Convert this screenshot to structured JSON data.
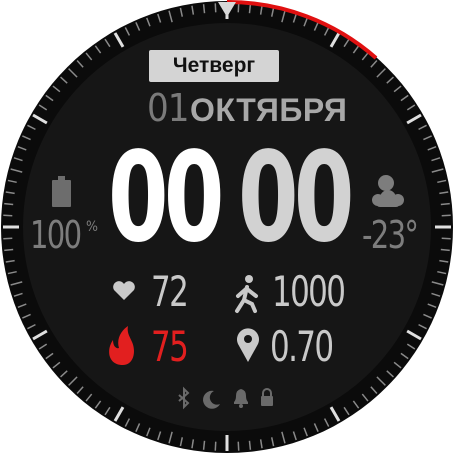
{
  "date": {
    "weekday": "Четверг",
    "day": "01",
    "month": "ОКТЯБРЯ"
  },
  "time": {
    "hours": "00",
    "minutes": "00"
  },
  "battery": {
    "value": "100",
    "unit": "%",
    "icon": "battery-icon",
    "level": 1.0
  },
  "weather": {
    "temperature": "-23°",
    "icon": "partly-cloudy-icon"
  },
  "stats": {
    "heart_rate": {
      "value": "72",
      "icon": "heart-icon"
    },
    "steps": {
      "value": "1000",
      "icon": "walking-icon"
    },
    "calories": {
      "value": "75",
      "icon": "flame-icon"
    },
    "distance": {
      "value": "0.70",
      "icon": "location-pin-icon"
    }
  },
  "status_icons": [
    "bluetooth-icon",
    "moon-icon",
    "bell-icon",
    "lock-icon"
  ],
  "colors": {
    "accent": "#e21f1f",
    "dial": "#151515",
    "bezel": "#0c0c0c",
    "text": "#ffffff"
  },
  "progress_arc": {
    "fraction": 0.12
  }
}
